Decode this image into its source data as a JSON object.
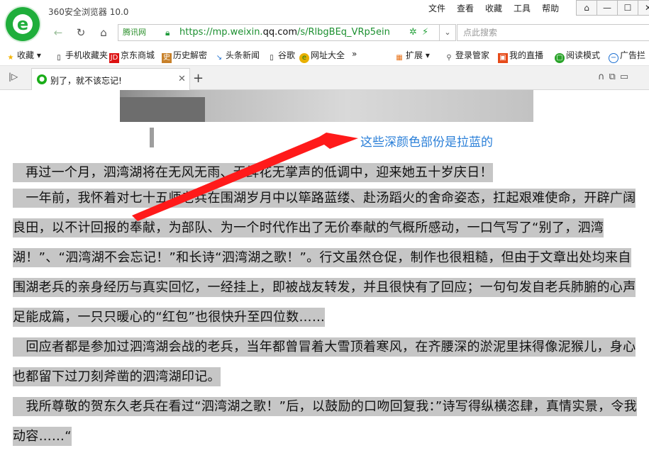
{
  "window": {
    "app_title": "360安全浏览器 10.0",
    "menu": [
      "文件",
      "查看",
      "收藏",
      "工具",
      "帮助"
    ],
    "controls": [
      "⌂",
      "—",
      "☐",
      "✕"
    ]
  },
  "navbar": {
    "secure_label": "腾讯网",
    "url_prefix": "https://mp.weixin.",
    "url_domain": "qq.com",
    "url_path": "/s/RlbgBEq_VRp5ein",
    "search_placeholder": "点此搜索"
  },
  "bookmarks": {
    "items": [
      "收藏",
      "手机收藏夹",
      "京东商城",
      "历史解密",
      "头条新闻",
      "谷歌",
      "网址大全"
    ],
    "more": "»",
    "right_items": [
      "扩展",
      "登录管家",
      "我的直播",
      "阅读模式",
      "广告拦"
    ]
  },
  "tabs": {
    "active_title": "别了，就不该忘记!"
  },
  "annotation": {
    "text": "这些深颜色部份是拉蓝的",
    "arrow_color": "#ff1a1a",
    "text_color": "#2a7fd8"
  },
  "article": {
    "p1": "再过一个月，泗湾湖将在无风无雨、无鲜花无掌声的低调中，迎来她五十岁庆日！",
    "p2": "一年前，我怀着对七十五师老兵在围湖岁月中以筚路蓝缕、赴汤蹈火的舍命姿态，扛起艰难使命，开辟广阔良田，以不计回报的奉献，为部队、为一个时代作出了无价奉献的气概所感动，一口气写了“别了，泗湾湖！”、“泗湾湖不会忘记！”和长诗“泗湾湖之歌！”。行文虽然仓促，制作也很粗糙，但由于文章出处均来自围湖老兵的亲身经历与真实回忆，一经挂上，即被战友转发，并且很快有了回应；一句句发自老兵肺腑的心声足能成篇，一只只暖心的“红包”也很快升至四位数……",
    "p3": "回应者都是参加过泗湾湖会战的老兵，当年都曾冒着大雪顶着寒风，在齐腰深的淤泥里抹得像泥猴儿，身心也都留下过刀刻斧凿的泗湾湖印记。",
    "p4": "我所尊敬的贺东久老兵在看过“泗湾湖之歌！”后，以鼓励的口吻回复我：”诗写得纵横恣肆，真情实景，令我动容……“"
  }
}
